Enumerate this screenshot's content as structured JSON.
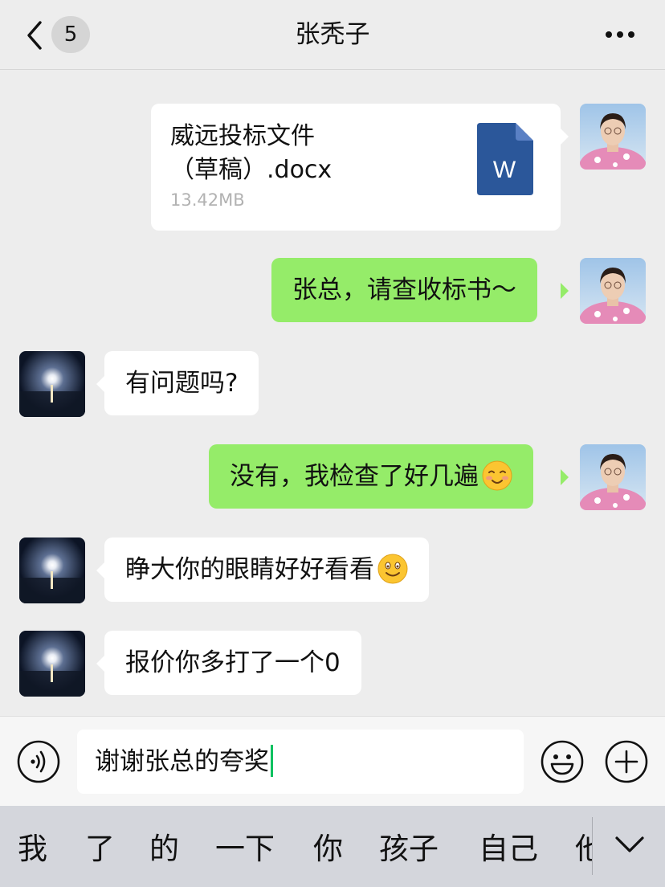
{
  "header": {
    "back_badge": "5",
    "title": "张秃子"
  },
  "file_message": {
    "file_name": "威远投标文件\n（草稿）.docx",
    "file_size": "13.42MB",
    "icon_letter": "W",
    "icon": "word-file-icon"
  },
  "messages": [
    {
      "side": "right",
      "text": "张总，请查收标书～"
    },
    {
      "side": "left",
      "text": "有问题吗?"
    },
    {
      "side": "right",
      "text": "没有，我检查了好几遍",
      "emoji": "blush-emoji-icon"
    },
    {
      "side": "left",
      "text": "睁大你的眼睛好好看看",
      "emoji": "smile-emoji-icon"
    },
    {
      "side": "left",
      "text": "报价你多打了一个0"
    }
  ],
  "input": {
    "value": "谢谢张总的夸奖"
  },
  "candidates": [
    "我",
    "了",
    "的",
    "一下",
    "你",
    "孩子",
    "自己",
    "他"
  ],
  "colors": {
    "background": "#ededed",
    "bubble_sent": "#95ec69",
    "bubble_received": "#ffffff",
    "word_icon": "#2b579a",
    "caret": "#07c160"
  }
}
